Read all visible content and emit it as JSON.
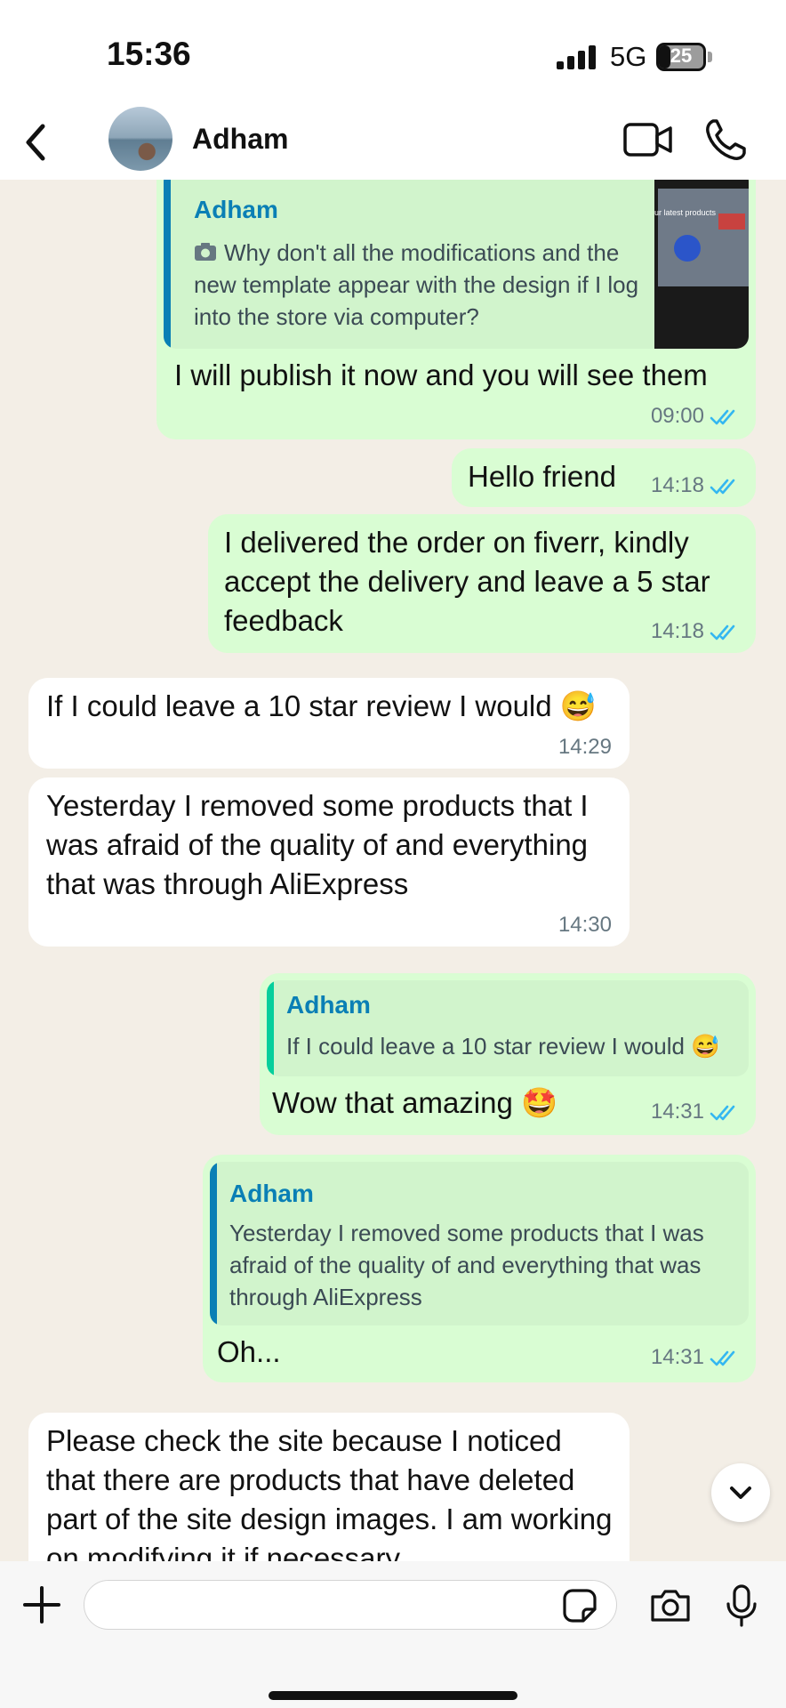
{
  "status_bar": {
    "time": "15:36",
    "network": "5G",
    "battery": "25",
    "battery_level": 0.25
  },
  "header": {
    "contact_name": "Adham"
  },
  "colors": {
    "outgoing_bubble": "#d9fdd3",
    "incoming_bubble": "#ffffff",
    "quote_name": "#0a7fb5",
    "read_ticks": "#34b7f1",
    "background": "#f3eee6"
  },
  "icons": [
    "back-chevron-icon",
    "video-call-icon",
    "phone-icon",
    "camera-small-icon",
    "double-check-icon",
    "chevron-down-icon",
    "plus-icon",
    "sticker-icon",
    "camera-icon",
    "microphone-icon"
  ],
  "messages": [
    {
      "direction": "out",
      "quote": {
        "author": "Adham",
        "text": "Why don't all the modifications and the new template appear with the design if I log into the store via computer?",
        "thumbnail_text": "ur latest products"
      },
      "text": "I will publish it now and you will see them",
      "time": "09:00",
      "status": "read"
    },
    {
      "direction": "out",
      "text": "Hello friend",
      "time": "14:18",
      "status": "read"
    },
    {
      "direction": "out",
      "text": "I delivered the order on fiverr, kindly accept the delivery and leave a 5 star feedback",
      "time": "14:18",
      "status": "read"
    },
    {
      "direction": "in",
      "text": "If I could leave a 10 star review I would 😅",
      "time": "14:29"
    },
    {
      "direction": "in",
      "text": "Yesterday I removed some products that I was afraid of the quality of and everything that was through AliExpress",
      "time": "14:30"
    },
    {
      "direction": "out",
      "quote": {
        "author": "Adham",
        "text": "If I could leave a 10 star review I would 😅"
      },
      "text": "Wow that amazing 🤩",
      "time": "14:31",
      "status": "read"
    },
    {
      "direction": "out",
      "quote": {
        "author": "Adham",
        "text": "Yesterday I removed some products that I was afraid of the quality of and everything that was through AliExpress"
      },
      "text": "Oh...",
      "time": "14:31",
      "status": "read"
    },
    {
      "direction": "in",
      "text": "Please check the site because I noticed that there are products that have deleted part of the site design images. I am working on modifying it if necessary"
    }
  ],
  "composer": {
    "value": ""
  }
}
